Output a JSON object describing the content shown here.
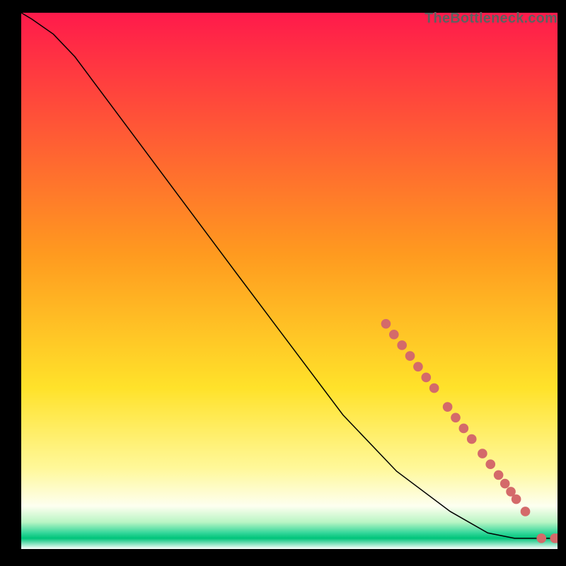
{
  "watermark": "TheBottleneck.com",
  "chart_data": {
    "type": "line",
    "title": "",
    "xlabel": "",
    "ylabel": "",
    "xlim": [
      0,
      100
    ],
    "ylim": [
      0,
      100
    ],
    "grid": false,
    "legend": false,
    "background_gradient": {
      "stops": [
        {
          "y_pct": 0,
          "color": "#ff1a4b"
        },
        {
          "y_pct": 45,
          "color": "#ff9a1f"
        },
        {
          "y_pct": 70,
          "color": "#ffe22a"
        },
        {
          "y_pct": 85,
          "color": "#fff89a"
        },
        {
          "y_pct": 92,
          "color": "#fdfff0"
        },
        {
          "y_pct": 95,
          "color": "#b9f5c4"
        },
        {
          "y_pct": 97,
          "color": "#33d69a"
        },
        {
          "y_pct": 98,
          "color": "#00c47a"
        },
        {
          "y_pct": 100,
          "color": "#ffffff"
        }
      ]
    },
    "series": [
      {
        "name": "curve",
        "color": "#000000",
        "points": [
          {
            "x": 0,
            "y": 100.0
          },
          {
            "x": 2,
            "y": 98.8
          },
          {
            "x": 6,
            "y": 96.0
          },
          {
            "x": 10,
            "y": 91.8
          },
          {
            "x": 20,
            "y": 78.4
          },
          {
            "x": 30,
            "y": 65.0
          },
          {
            "x": 40,
            "y": 51.6
          },
          {
            "x": 50,
            "y": 38.3
          },
          {
            "x": 60,
            "y": 25.0
          },
          {
            "x": 70,
            "y": 14.5
          },
          {
            "x": 80,
            "y": 7.0
          },
          {
            "x": 87,
            "y": 3.0
          },
          {
            "x": 92,
            "y": 2.0
          },
          {
            "x": 97,
            "y": 2.0
          },
          {
            "x": 100,
            "y": 2.0
          }
        ]
      }
    ],
    "highlight_markers": {
      "color": "#d46a6a",
      "radius_pct": 0.9,
      "points": [
        {
          "x": 68.0,
          "y": 42.0
        },
        {
          "x": 69.5,
          "y": 40.0
        },
        {
          "x": 71.0,
          "y": 38.0
        },
        {
          "x": 72.5,
          "y": 36.0
        },
        {
          "x": 74.0,
          "y": 34.0
        },
        {
          "x": 75.5,
          "y": 32.0
        },
        {
          "x": 77.0,
          "y": 30.0
        },
        {
          "x": 79.5,
          "y": 26.5
        },
        {
          "x": 81.0,
          "y": 24.5
        },
        {
          "x": 82.5,
          "y": 22.5
        },
        {
          "x": 84.0,
          "y": 20.5
        },
        {
          "x": 86.0,
          "y": 17.8
        },
        {
          "x": 87.5,
          "y": 15.8
        },
        {
          "x": 89.0,
          "y": 13.8
        },
        {
          "x": 90.2,
          "y": 12.2
        },
        {
          "x": 91.3,
          "y": 10.7
        },
        {
          "x": 92.3,
          "y": 9.3
        },
        {
          "x": 94.0,
          "y": 7.0
        },
        {
          "x": 97.0,
          "y": 2.0
        },
        {
          "x": 99.5,
          "y": 2.0
        },
        {
          "x": 100.0,
          "y": 2.0
        }
      ]
    }
  }
}
